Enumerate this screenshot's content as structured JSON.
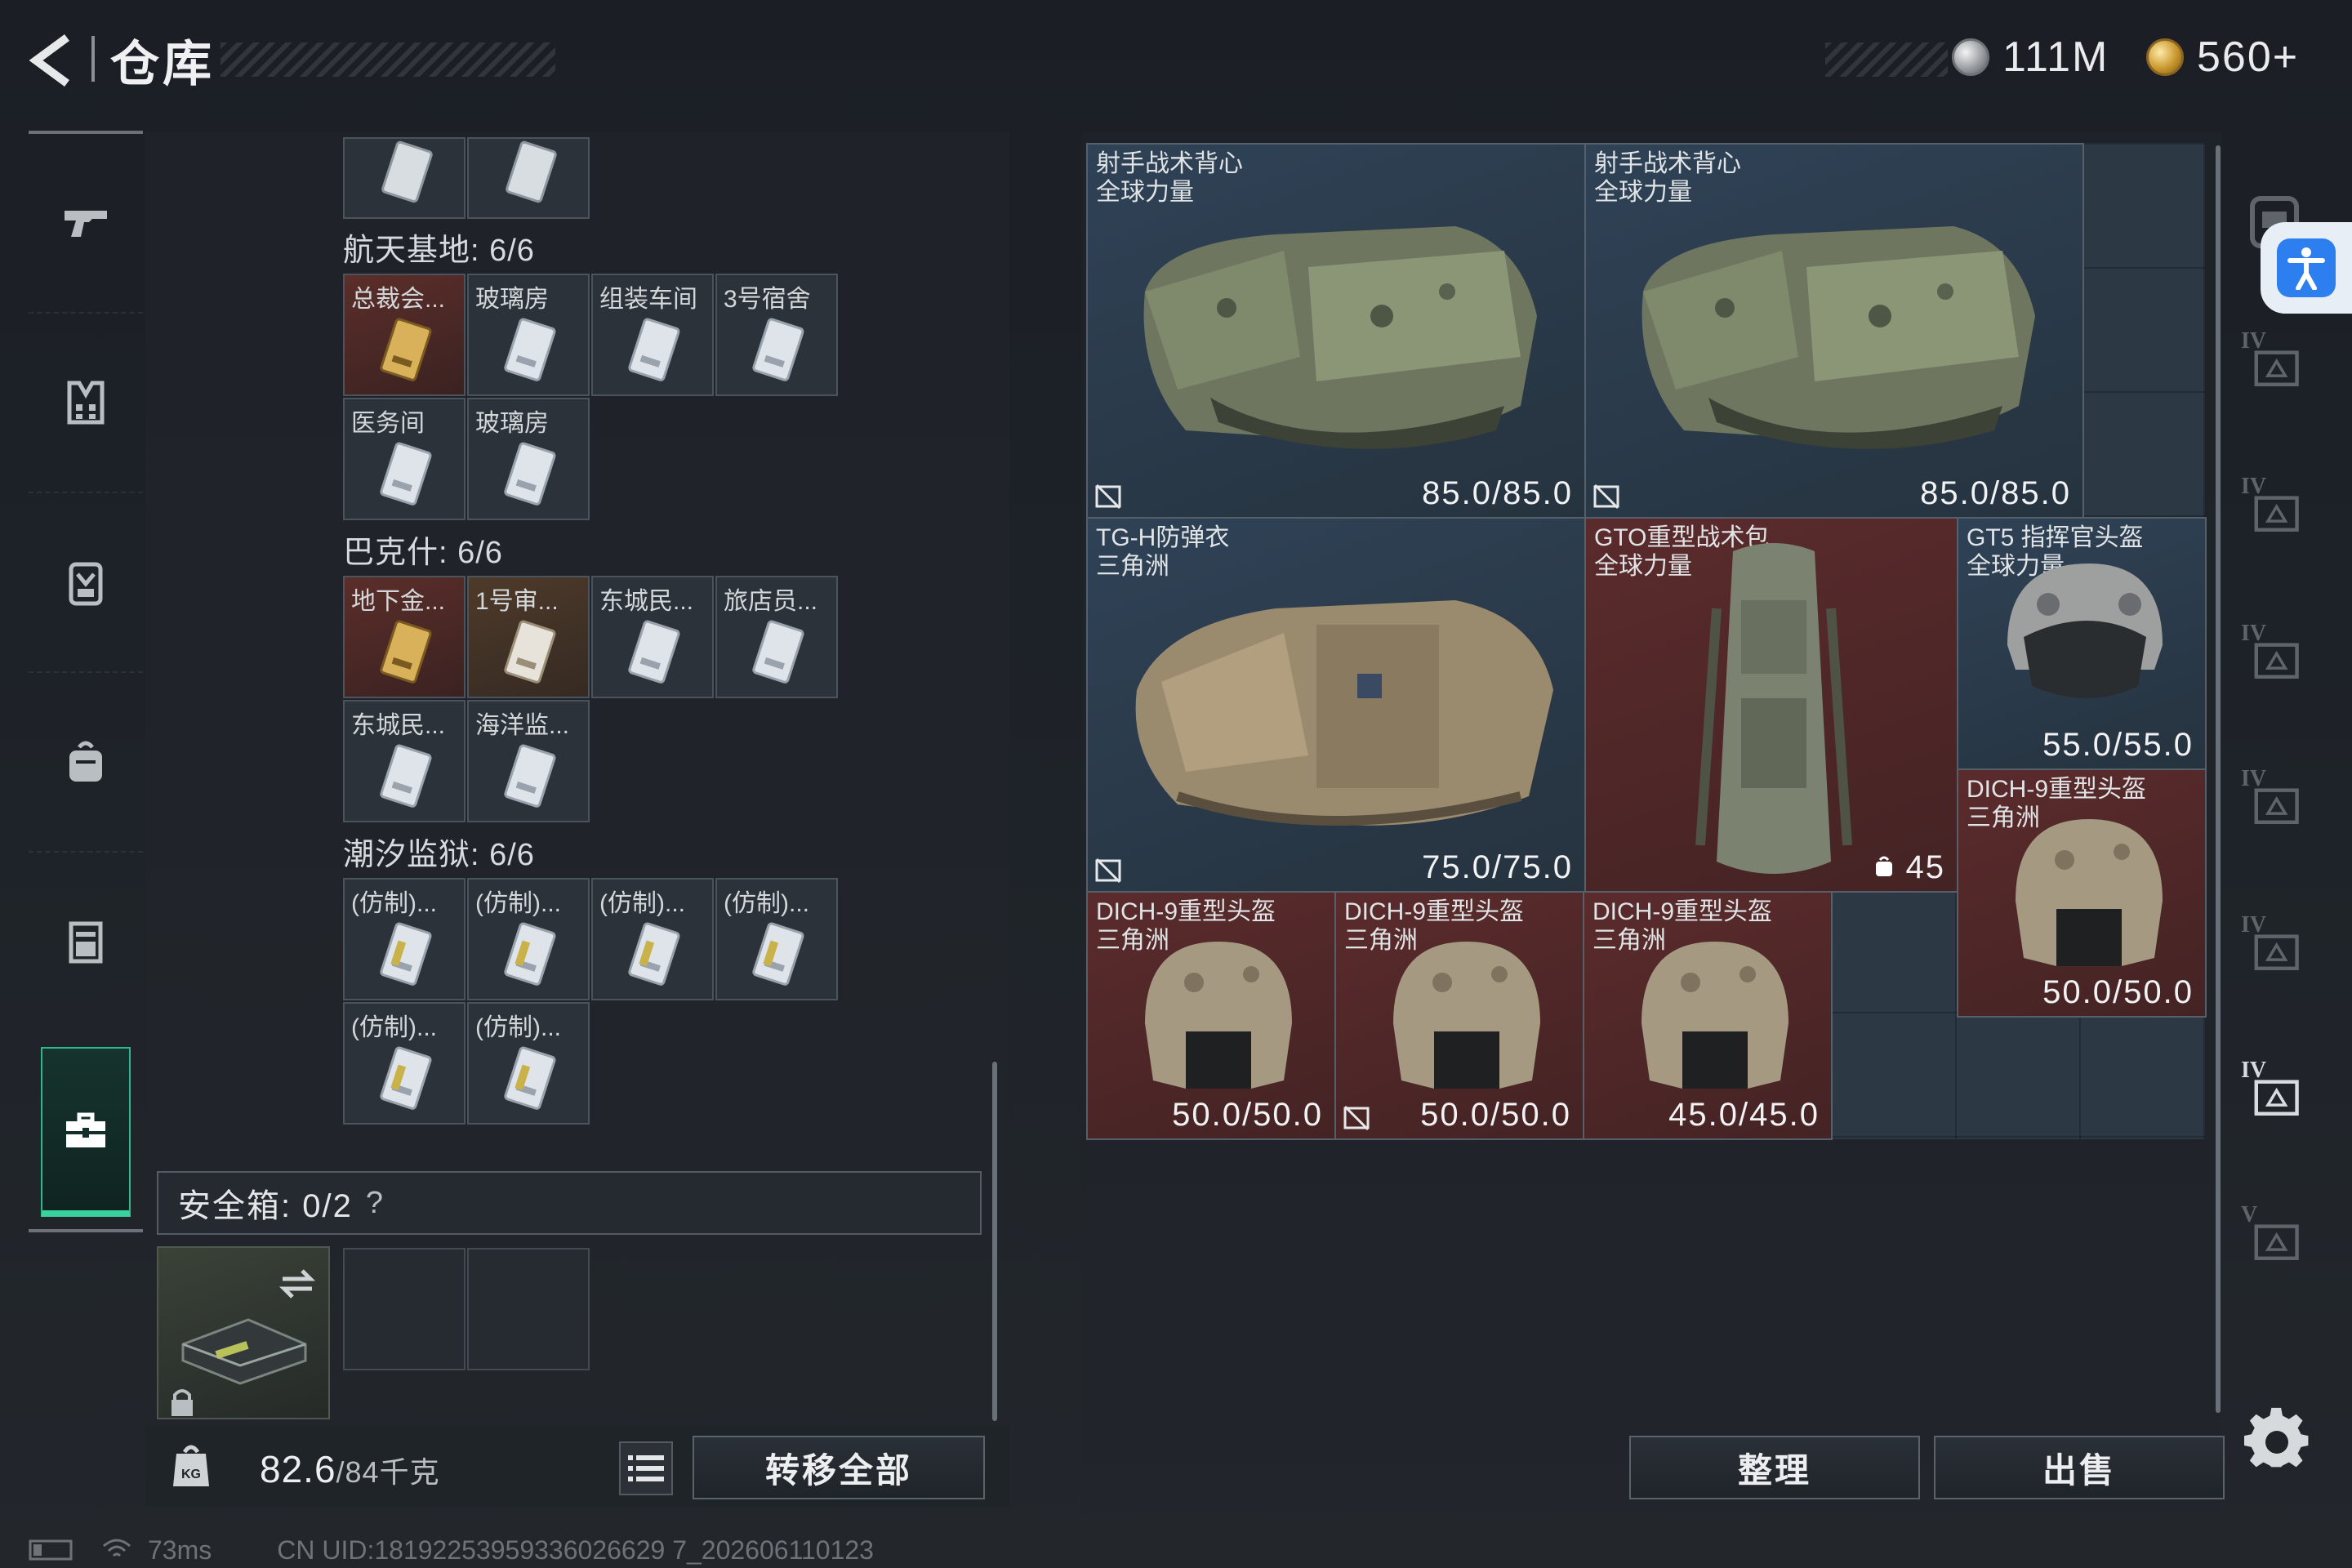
{
  "header": {
    "title": "仓库",
    "currency_silver": "111M",
    "currency_gold": "560+"
  },
  "status": {
    "ping": "73ms",
    "uid": "CN UID:18192253959336026629 7_202606110123"
  },
  "stash": {
    "groups": [
      {
        "label": "航天基地: 6/6",
        "items": [
          {
            "label": "总裁会...",
            "rarity": "rare"
          },
          {
            "label": "玻璃房",
            "rarity": "common"
          },
          {
            "label": "组装车间",
            "rarity": "common"
          },
          {
            "label": "3号宿舍",
            "rarity": "common"
          },
          {
            "label": "医务间",
            "rarity": "common"
          },
          {
            "label": "玻璃房",
            "rarity": "common"
          }
        ]
      },
      {
        "label": "巴克什: 6/6",
        "items": [
          {
            "label": "地下金...",
            "rarity": "rare"
          },
          {
            "label": "1号审...",
            "rarity": "epic"
          },
          {
            "label": "东城民...",
            "rarity": "common"
          },
          {
            "label": "旅店员...",
            "rarity": "common"
          },
          {
            "label": "东城民...",
            "rarity": "common"
          },
          {
            "label": "海洋监...",
            "rarity": "common"
          }
        ]
      },
      {
        "label": "潮汐监狱: 6/6",
        "items": [
          {
            "label": "(仿制)...",
            "rarity": "common"
          },
          {
            "label": "(仿制)...",
            "rarity": "common"
          },
          {
            "label": "(仿制)...",
            "rarity": "common"
          },
          {
            "label": "(仿制)...",
            "rarity": "common"
          },
          {
            "label": "(仿制)...",
            "rarity": "common"
          },
          {
            "label": "(仿制)...",
            "rarity": "common"
          }
        ]
      }
    ],
    "safebox_label": "安全箱: 0/2",
    "safebox_help": "?",
    "weight_current": "82.6",
    "weight_max": "/84千克",
    "transfer_all": "转移全部"
  },
  "equipment": {
    "items": [
      {
        "name": "射手战术背心",
        "sub": "全球力量",
        "durability": "85.0/85.0",
        "color": "blue"
      },
      {
        "name": "射手战术背心",
        "sub": "全球力量",
        "durability": "85.0/85.0",
        "color": "blue"
      },
      {
        "name": "TG-H防弹衣",
        "sub": "三角洲",
        "durability": "75.0/75.0",
        "color": "blue"
      },
      {
        "name": "GTO重型战术包",
        "sub": "全球力量",
        "durability": "45",
        "color": "red"
      },
      {
        "name": "GT5 指挥官头盔",
        "sub": "全球力量",
        "durability": "55.0/55.0",
        "color": "blue"
      },
      {
        "name": "DICH-9重型头盔",
        "sub": "三角洲",
        "durability": "50.0/50.0",
        "color": "red"
      },
      {
        "name": "DICH-9重型头盔",
        "sub": "三角洲",
        "durability": "50.0/50.0",
        "color": "red"
      },
      {
        "name": "DICH-9重型头盔",
        "sub": "三角洲",
        "durability": "50.0/50.0",
        "color": "red"
      },
      {
        "name": "DICH-9重型头盔",
        "sub": "三角洲",
        "durability": "45.0/45.0",
        "color": "red"
      }
    ],
    "sort_label": "整理",
    "sell_label": "出售"
  },
  "rail": {
    "tiers": [
      "IV",
      "IV",
      "IV",
      "IV",
      "IV",
      "IV",
      "V"
    ]
  },
  "colors": {
    "accent_green": "#39d29c",
    "rare_red": "#5b2b2c",
    "blue_cell": "#2f4256",
    "gold": "#c9982e"
  },
  "icons": {
    "nav": [
      "pistol-icon",
      "armor-vest-icon",
      "backpack-icon",
      "bag-icon",
      "chest-rig-icon",
      "briefcase-icon"
    ]
  }
}
